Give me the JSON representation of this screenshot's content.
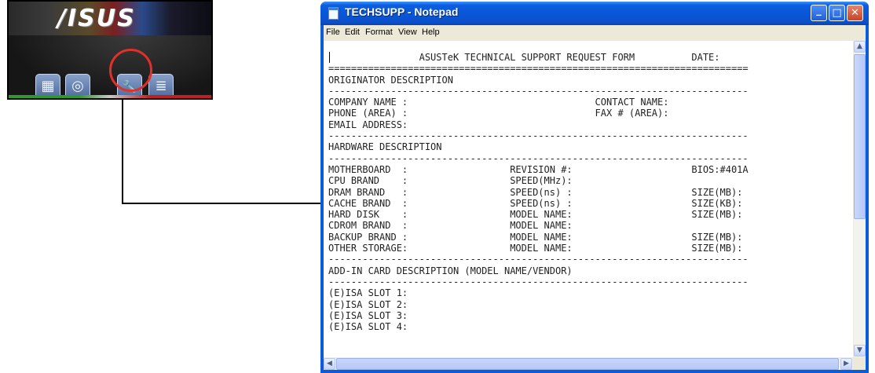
{
  "asus_panel": {
    "logo_text": "/ISUS",
    "buttons": [
      {
        "name": "drivers-button",
        "icon": "calculator-icon",
        "glyph": "▦"
      },
      {
        "name": "cd-button",
        "icon": "disc-icon",
        "glyph": "◎"
      },
      {
        "name": "tech-support-button",
        "icon": "wrench-icon",
        "glyph": "🔧"
      },
      {
        "name": "readme-button",
        "icon": "document-icon",
        "glyph": "≣"
      }
    ],
    "highlight_color": "#e0302a"
  },
  "notepad": {
    "title": "TECHSUPP - Notepad",
    "window_controls": {
      "minimize": "_",
      "maximize": "□",
      "close": "✕"
    },
    "menu": [
      "File",
      "Edit",
      "Format",
      "View",
      "Help"
    ],
    "scroll_glyphs": {
      "up": "▲",
      "down": "▼",
      "left": "◀",
      "right": "▶"
    },
    "document_lines": [
      "                ASUSTeK TECHNICAL SUPPORT REQUEST FORM          DATE:",
      "==========================================================================",
      "ORIGINATOR DESCRIPTION",
      "--------------------------------------------------------------------------",
      "COMPANY NAME :                                 CONTACT NAME:",
      "PHONE (AREA) :                                 FAX # (AREA):",
      "EMAIL ADDRESS:",
      "--------------------------------------------------------------------------",
      "HARDWARE DESCRIPTION",
      "--------------------------------------------------------------------------",
      "MOTHERBOARD  :                  REVISION #:                     BIOS:#401A",
      "CPU BRAND    :                  SPEED(MHz):",
      "DRAM BRAND   :                  SPEED(ns) :                     SIZE(MB):",
      "CACHE BRAND  :                  SPEED(ns) :                     SIZE(KB):",
      "HARD DISK    :                  MODEL NAME:                     SIZE(MB):",
      "CDROM BRAND  :                  MODEL NAME:",
      "BACKUP BRAND :                  MODEL NAME:                     SIZE(MB):",
      "OTHER STORAGE:                  MODEL NAME:                     SIZE(MB):",
      "--------------------------------------------------------------------------",
      "ADD-IN CARD DESCRIPTION (MODEL NAME/VENDOR)",
      "--------------------------------------------------------------------------",
      "(E)ISA SLOT 1:",
      "(E)ISA SLOT 2:",
      "(E)ISA SLOT 3:",
      "(E)ISA SLOT 4:"
    ]
  },
  "colors": {
    "titlebar_blue": "#0a55d6",
    "close_red": "#c8432a",
    "menu_bg": "#ece9d8"
  }
}
